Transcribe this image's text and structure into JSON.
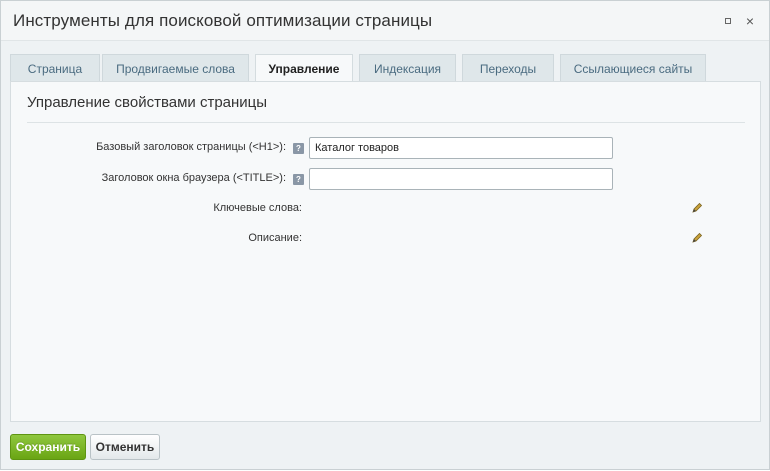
{
  "dialog": {
    "title": "Инструменты для поисковой оптимизации страницы",
    "controls": {
      "restore_icon": "restore-icon",
      "close_glyph": "×"
    }
  },
  "tabs": [
    {
      "label": "Страница",
      "active": false
    },
    {
      "label": "Продвигаемые слова",
      "active": false
    },
    {
      "label": "Управление",
      "active": true
    },
    {
      "label": "Индексация",
      "active": false
    },
    {
      "label": "Переходы",
      "active": false
    },
    {
      "label": "Ссылающиеся сайты",
      "active": false
    }
  ],
  "panel": {
    "heading": "Управление свойствами страницы",
    "fields": {
      "h1_label": "Базовый заголовок страницы (<H1>):",
      "h1_value": "Каталог товаров",
      "title_label": "Заголовок окна браузера (<TITLE>):",
      "title_value": "",
      "keywords_label": "Ключевые слова:",
      "description_label": "Описание:",
      "help_glyph": "?"
    }
  },
  "footer": {
    "save_label": "Сохранить",
    "cancel_label": "Отменить"
  },
  "colors": {
    "save_button": "#6aa514",
    "active_tab_bg": "#f7f9fa",
    "tab_bg": "#dfe7ea",
    "panel_bg": "#f7f9fa"
  }
}
